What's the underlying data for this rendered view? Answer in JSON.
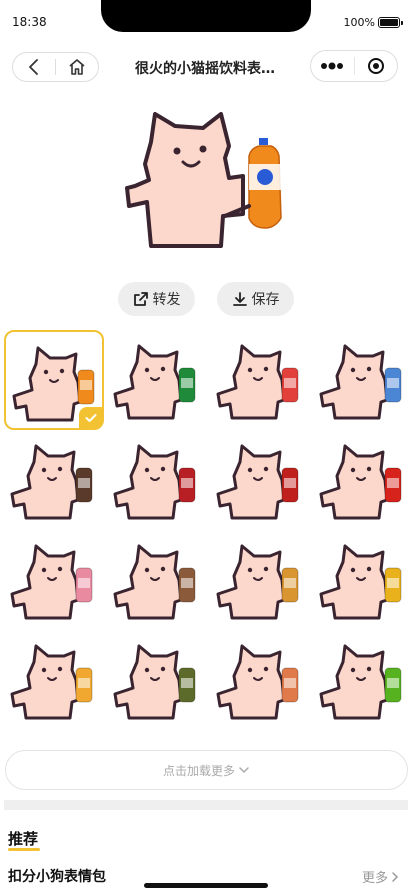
{
  "status_bar": {
    "time": "18:38",
    "battery": "100%"
  },
  "nav": {
    "title": "很火的小猫摇饮料表…"
  },
  "actions": {
    "forward_label": "转发",
    "save_label": "保存"
  },
  "grid": {
    "items": [
      {
        "name": "cat-orange-soda",
        "drink": "#f08a1c",
        "selected": true
      },
      {
        "name": "cat-green-bottle",
        "drink": "#1f8b3a",
        "selected": false
      },
      {
        "name": "cat-watermelon",
        "drink": "#e2403a",
        "selected": false
      },
      {
        "name": "cat-milk-carton",
        "drink": "#4b86d4",
        "selected": false
      },
      {
        "name": "cat-starbucks-cup",
        "drink": "#5a3a2a",
        "selected": false
      },
      {
        "name": "cat-baijiu-bottle",
        "drink": "#b81f25",
        "selected": false
      },
      {
        "name": "cat-red-can",
        "drink": "#c0201c",
        "selected": false
      },
      {
        "name": "cat-kfc-bucket",
        "drink": "#d6231c",
        "selected": false
      },
      {
        "name": "cat-pink-tea",
        "drink": "#e98aa0",
        "selected": false
      },
      {
        "name": "cat-bubble-tea",
        "drink": "#8b5a3a",
        "selected": false
      },
      {
        "name": "cat-fried-chicken",
        "drink": "#d99530",
        "selected": false
      },
      {
        "name": "cat-yellow-cup",
        "drink": "#e9b21c",
        "selected": false
      },
      {
        "name": "cat-mango-drink",
        "drink": "#f0a830",
        "selected": false
      },
      {
        "name": "cat-snack-stick",
        "drink": "#5d6b2a",
        "selected": false
      },
      {
        "name": "cat-noodle-cup",
        "drink": "#e07a4a",
        "selected": false
      },
      {
        "name": "cat-sprite-bottle",
        "drink": "#56b31f",
        "selected": false
      }
    ]
  },
  "load_more": {
    "label": "点击加载更多"
  },
  "recommend": {
    "section_title": "推荐",
    "pack_title": "扣分小狗表情包",
    "more_label": "更多"
  },
  "colors": {
    "accent": "#f2c233",
    "cat_fill": "#fcd7cb",
    "cat_outline": "#3a2430"
  }
}
